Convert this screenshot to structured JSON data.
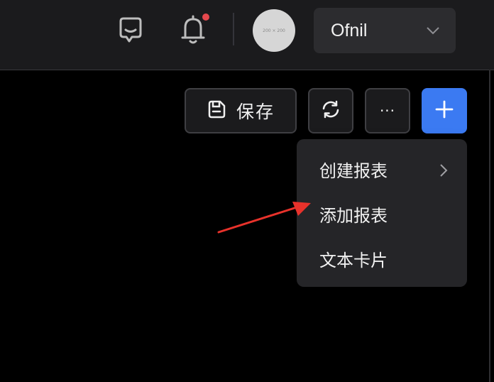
{
  "header": {
    "avatar_placeholder": "200 × 200",
    "user": {
      "name": "Ofnil"
    },
    "icons": {
      "chat": "chat-icon",
      "notifications": "bell-icon",
      "user_menu": "chevron-down-icon"
    },
    "notification_dot_color": "#e5484d"
  },
  "toolbar": {
    "save_label": "保存",
    "more_label": "···",
    "icons": {
      "save": "save-icon",
      "refresh": "refresh-icon",
      "add": "plus-icon"
    },
    "add_button_color": "#3b7af2"
  },
  "dropdown": {
    "items": [
      {
        "label": "创建报表",
        "has_submenu": true
      },
      {
        "label": "添加报表",
        "has_submenu": false
      },
      {
        "label": "文本卡片",
        "has_submenu": false
      }
    ]
  },
  "annotation": {
    "arrow_color": "#e8322b"
  }
}
